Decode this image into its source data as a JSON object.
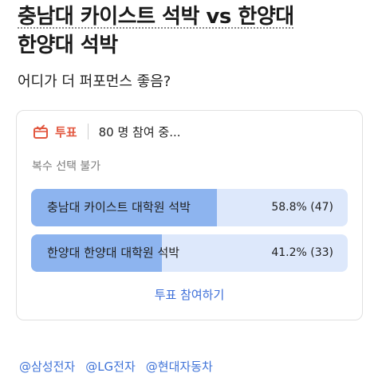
{
  "post": {
    "title_line1": "충남대 카이스트 석박 vs 한양대",
    "title_line2": "한양대 석박",
    "question": "어디가 더 퍼포먼스 좋음?"
  },
  "poll": {
    "tag_label": "투표",
    "tag_icon": "ballot-box-icon",
    "participants": "80 명 참여 중...",
    "note": "복수 선택 불가",
    "options": [
      {
        "label": "충남대 카이스트 대학원 석박",
        "result": "58.8% (47)",
        "percent": 58.8
      },
      {
        "label": "한양대 한양대 대학원 석박",
        "result": "41.2% (33)",
        "percent": 41.2
      }
    ],
    "vote_label": "투표 참여하기"
  },
  "tags": [
    "@삼성전자",
    "@LG전자",
    "@현대자동차"
  ],
  "colors": {
    "accent_red": "#e2573f",
    "bar_fill": "#8db4ef",
    "bar_track": "#dde8fb",
    "link_blue": "#3d6fd9"
  }
}
